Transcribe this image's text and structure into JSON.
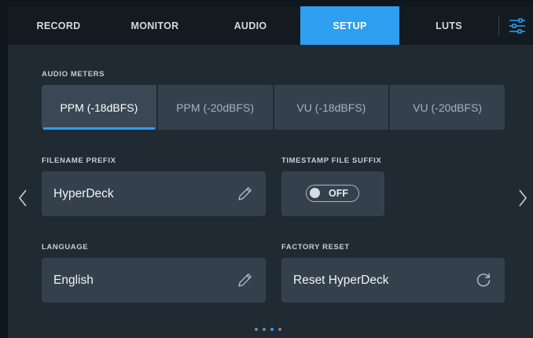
{
  "tabs": [
    {
      "label": "RECORD",
      "active": false
    },
    {
      "label": "MONITOR",
      "active": false
    },
    {
      "label": "AUDIO",
      "active": false
    },
    {
      "label": "SETUP",
      "active": true
    },
    {
      "label": "LUTS",
      "active": false
    }
  ],
  "audio_meters": {
    "label": "AUDIO METERS",
    "options": [
      "PPM (-18dBFS)",
      "PPM (-20dBFS)",
      "VU (-18dBFS)",
      "VU (-20dBFS)"
    ],
    "selected": "PPM (-18dBFS)"
  },
  "filename_prefix": {
    "label": "FILENAME PREFIX",
    "value": "HyperDeck"
  },
  "timestamp_suffix": {
    "label": "TIMESTAMP FILE SUFFIX",
    "state": "OFF"
  },
  "language": {
    "label": "LANGUAGE",
    "value": "English"
  },
  "factory_reset": {
    "label": "FACTORY RESET",
    "button": "Reset HyperDeck"
  },
  "pagination": {
    "total": 4,
    "current": 3
  },
  "colors": {
    "accent": "#2d9ef0",
    "panel": "#34414d",
    "background": "#1f2a33"
  },
  "icons": {
    "settings": "sliders-icon",
    "edit": "pencil-icon",
    "reset": "refresh-icon",
    "prev": "chevron-left-icon",
    "next": "chevron-right-icon"
  }
}
